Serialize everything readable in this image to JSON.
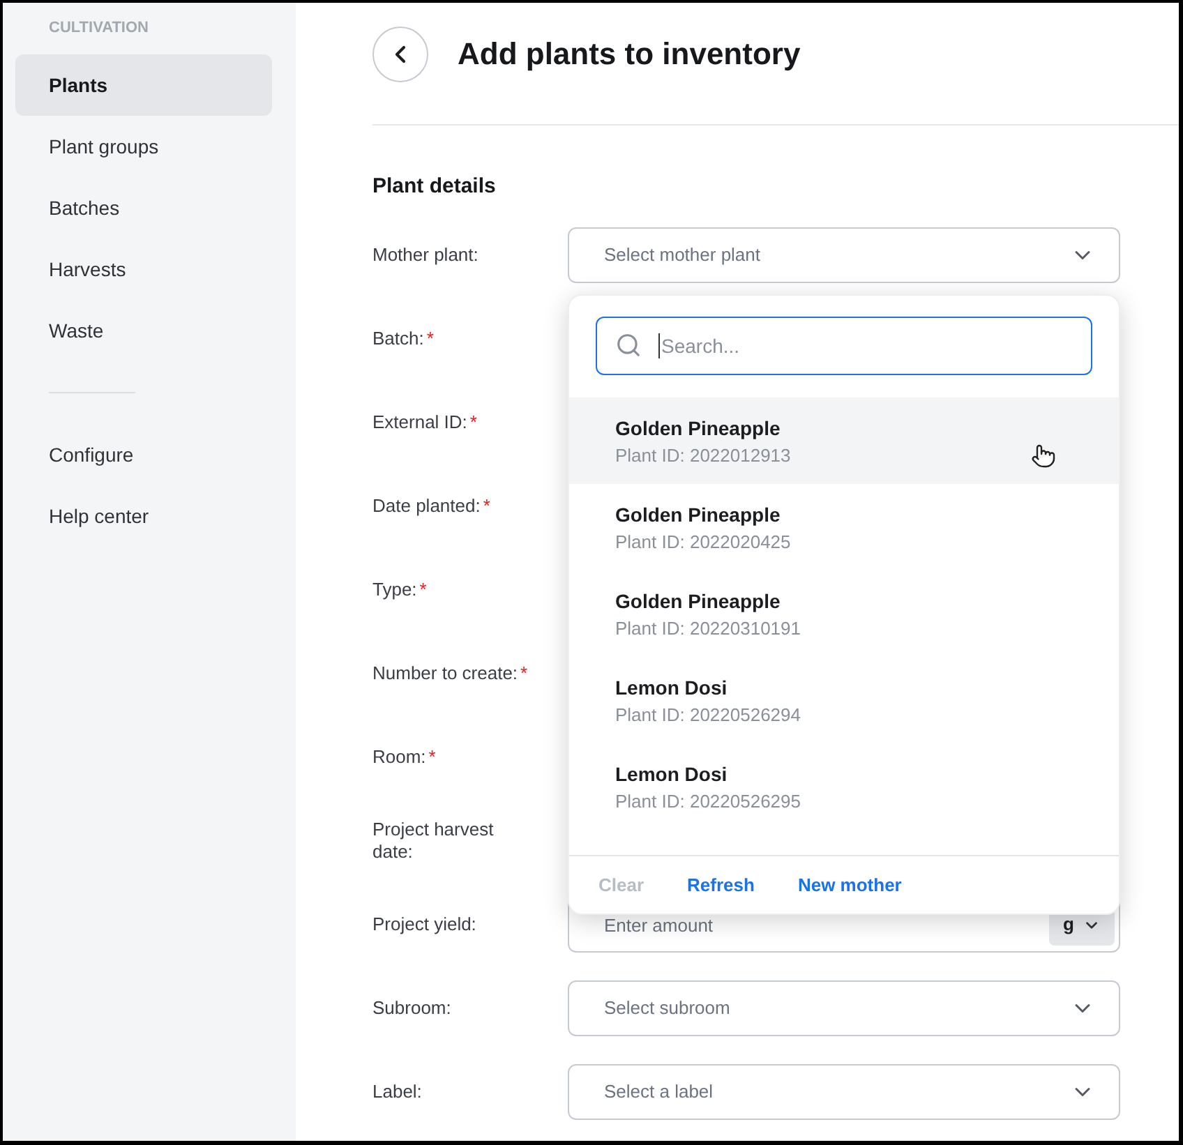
{
  "sidebar": {
    "section_title": "CULTIVATION",
    "groups": [
      {
        "items": [
          {
            "label": "Plants",
            "selected": true
          },
          {
            "label": "Plant groups",
            "selected": false
          },
          {
            "label": "Batches",
            "selected": false
          },
          {
            "label": "Harvests",
            "selected": false
          },
          {
            "label": "Waste",
            "selected": false
          }
        ]
      },
      {
        "items": [
          {
            "label": "Configure",
            "selected": false
          },
          {
            "label": "Help center",
            "selected": false
          }
        ]
      }
    ]
  },
  "header": {
    "title": "Add plants to inventory"
  },
  "form": {
    "section_title": "Plant details",
    "fields": [
      {
        "label": "Mother plant:",
        "control": {
          "kind": "select",
          "placeholder": "Select mother plant",
          "dropdown": {
            "search": {
              "placeholder": "Search...",
              "focused": true
            },
            "options": [
              {
                "name": "Golden Pineapple",
                "detail": "Plant ID: 2022012913",
                "hovered": true
              },
              {
                "name": "Golden Pineapple",
                "detail": "Plant ID: 2022020425",
                "hovered": false
              },
              {
                "name": "Golden Pineapple",
                "detail": "Plant ID: 20220310191",
                "hovered": false
              },
              {
                "name": "Lemon Dosi",
                "detail": "Plant ID: 20220526294",
                "hovered": false
              },
              {
                "name": "Lemon Dosi",
                "detail": "Plant ID: 20220526295",
                "hovered": false
              }
            ],
            "actions": [
              {
                "label": "Clear",
                "disabled": true
              },
              {
                "label": "Refresh",
                "disabled": false
              },
              {
                "label": "New mother",
                "disabled": false
              }
            ]
          }
        }
      },
      {
        "label": "Batch:",
        "required_mark": "*"
      },
      {
        "label": "External ID:",
        "required_mark": "*"
      },
      {
        "label": "Date planted:",
        "required_mark": "*"
      },
      {
        "label": "Type:",
        "required_mark": "*"
      },
      {
        "label": "Number to create:",
        "required_mark": "*"
      },
      {
        "label": "Room:",
        "required_mark": "*"
      },
      {
        "label": "Project harvest date:"
      },
      {
        "label": "Project yield:",
        "control": {
          "kind": "amount",
          "placeholder": "Enter amount",
          "unit": "g"
        }
      },
      {
        "label": "Subroom:",
        "control": {
          "kind": "select",
          "placeholder": "Select subroom"
        }
      },
      {
        "label": "Label:",
        "control": {
          "kind": "select",
          "placeholder": "Select a label"
        }
      }
    ]
  }
}
